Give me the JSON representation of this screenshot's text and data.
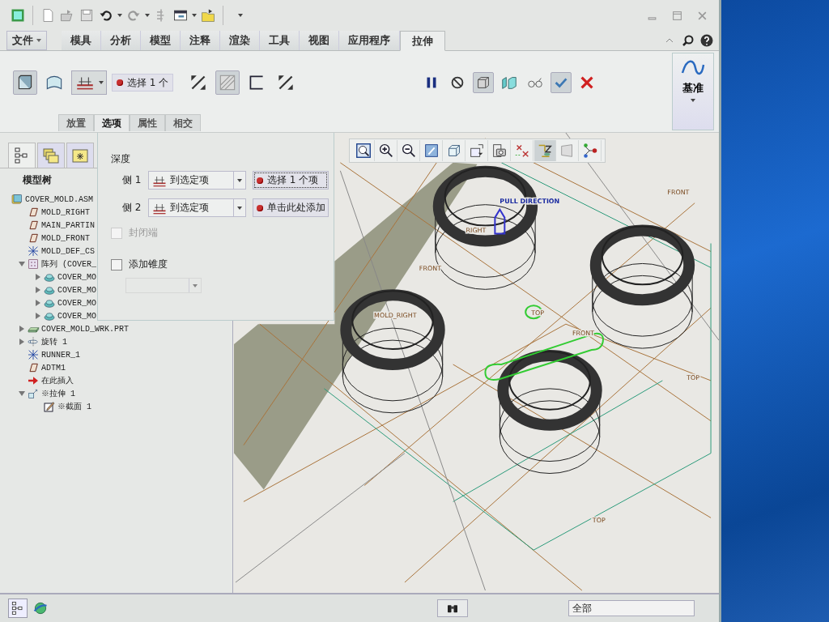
{
  "tabs": [
    {
      "label": "文件",
      "kind": "menu",
      "selected": false
    },
    {
      "label": "模具",
      "kind": "tab",
      "selected": false
    },
    {
      "label": "分析",
      "kind": "tab",
      "selected": false
    },
    {
      "label": "模型",
      "kind": "tab",
      "selected": false
    },
    {
      "label": "注释",
      "kind": "tab",
      "selected": false
    },
    {
      "label": "渲染",
      "kind": "tab",
      "selected": false
    },
    {
      "label": "工具",
      "kind": "tab",
      "selected": false
    },
    {
      "label": "视图",
      "kind": "tab",
      "selected": false
    },
    {
      "label": "应用程序",
      "kind": "tab",
      "selected": false
    },
    {
      "label": "拉伸",
      "kind": "tab",
      "selected": true
    }
  ],
  "ribbon": {
    "feature_tools": [
      {
        "kind": "solid",
        "pressed": true
      },
      {
        "kind": "surface",
        "pressed": false
      }
    ],
    "collector": "选择 1 个",
    "option_tools": [
      {
        "kind": "flip",
        "pressed": false
      },
      {
        "kind": "thicken",
        "pressed": true
      },
      {
        "kind": "remove",
        "pressed": false
      },
      {
        "kind": "flip",
        "pressed": false
      }
    ],
    "control_tools": [
      {
        "kind": "pause",
        "pressed": false
      },
      {
        "kind": "nopreview",
        "pressed": false
      },
      {
        "kind": "box",
        "pressed": true
      },
      {
        "kind": "verify",
        "pressed": false
      },
      {
        "kind": "glasses",
        "pressed": false
      },
      {
        "kind": "ok",
        "pressed": true
      },
      {
        "kind": "cancel",
        "pressed": false
      }
    ],
    "datum_group": {
      "label": "基准"
    }
  },
  "sub_tabs": [
    {
      "label": "放置",
      "selected": false
    },
    {
      "label": "选项",
      "selected": true
    },
    {
      "label": "属性",
      "selected": false
    },
    {
      "label": "相交",
      "selected": false
    }
  ],
  "options_panel": {
    "heading": "深度",
    "sides": [
      {
        "label": "侧 1",
        "depth": "到选定项",
        "reference": "选择 1 个项",
        "focused": true
      },
      {
        "label": "侧 2",
        "depth": "到选定项",
        "reference": "单击此处添加",
        "focused": false
      }
    ],
    "capped_ends": {
      "label": "封闭端",
      "checked": false,
      "disabled": true
    },
    "taper": {
      "label": "添加锥度",
      "checked": false,
      "disabled": false
    }
  },
  "navigator_tabs": [
    {
      "kind": "tree",
      "selected": true
    },
    {
      "kind": "folders",
      "selected": false
    },
    {
      "kind": "favorites",
      "selected": false
    }
  ],
  "model_tree": {
    "title": "模型树",
    "items": [
      {
        "label": "COVER_MOLD.ASM",
        "kind": "asm",
        "children": [
          {
            "label": "MOLD_RIGHT",
            "kind": "plane"
          },
          {
            "label": "MAIN_PARTIN",
            "kind": "plane"
          },
          {
            "label": "MOLD_FRONT",
            "kind": "plane"
          },
          {
            "label": "MOLD_DEF_CS",
            "kind": "csys"
          },
          {
            "label": "阵列 (COVER_",
            "kind": "pattern",
            "expanded": true,
            "children": [
              {
                "label": "COVER_MO",
                "kind": "part",
                "expanded": false
              },
              {
                "label": "COVER_MO",
                "kind": "part",
                "expanded": false
              },
              {
                "label": "COVER_MO",
                "kind": "part",
                "expanded": false
              },
              {
                "label": "COVER_MO",
                "kind": "part",
                "expanded": false
              }
            ]
          },
          {
            "label": "COVER_MOLD_WRK.PRT",
            "kind": "workpiece",
            "expanded": false
          },
          {
            "label": "旋转 1",
            "kind": "revolve",
            "expanded": false
          },
          {
            "label": "RUNNER_1",
            "kind": "csys"
          },
          {
            "label": "ADTM1",
            "kind": "plane"
          },
          {
            "label": "在此插入",
            "kind": "insert"
          },
          {
            "label": "※拉伸 1",
            "kind": "extrude",
            "expanded": true,
            "children": [
              {
                "label": "※截面 1",
                "kind": "sketch"
              }
            ]
          }
        ]
      }
    ]
  },
  "view_toolbar": [
    {
      "kind": "refit",
      "pressed": false
    },
    {
      "kind": "zoomin",
      "pressed": false
    },
    {
      "kind": "zoomout",
      "pressed": false
    },
    {
      "kind": "repaint",
      "pressed": false
    },
    {
      "kind": "style",
      "pressed": false
    },
    {
      "kind": "views",
      "pressed": false
    },
    {
      "kind": "snapshot",
      "pressed": false
    },
    {
      "kind": "datums",
      "pressed": false
    },
    {
      "kind": "spin",
      "pressed": true
    },
    {
      "kind": "saved",
      "pressed": false
    },
    {
      "kind": "network",
      "pressed": false
    }
  ],
  "viewport": {
    "labels": [
      {
        "text": "PULL DIRECTION"
      },
      {
        "text": "FRONT"
      },
      {
        "text": "FRONT"
      },
      {
        "text": "FRONT"
      },
      {
        "text": "TOP"
      },
      {
        "text": "TOP"
      },
      {
        "text": "TOP"
      },
      {
        "text": "MOLD_RIGHT"
      },
      {
        "text": "RIGHT"
      }
    ]
  },
  "status_bar": {
    "filter": "全部"
  }
}
